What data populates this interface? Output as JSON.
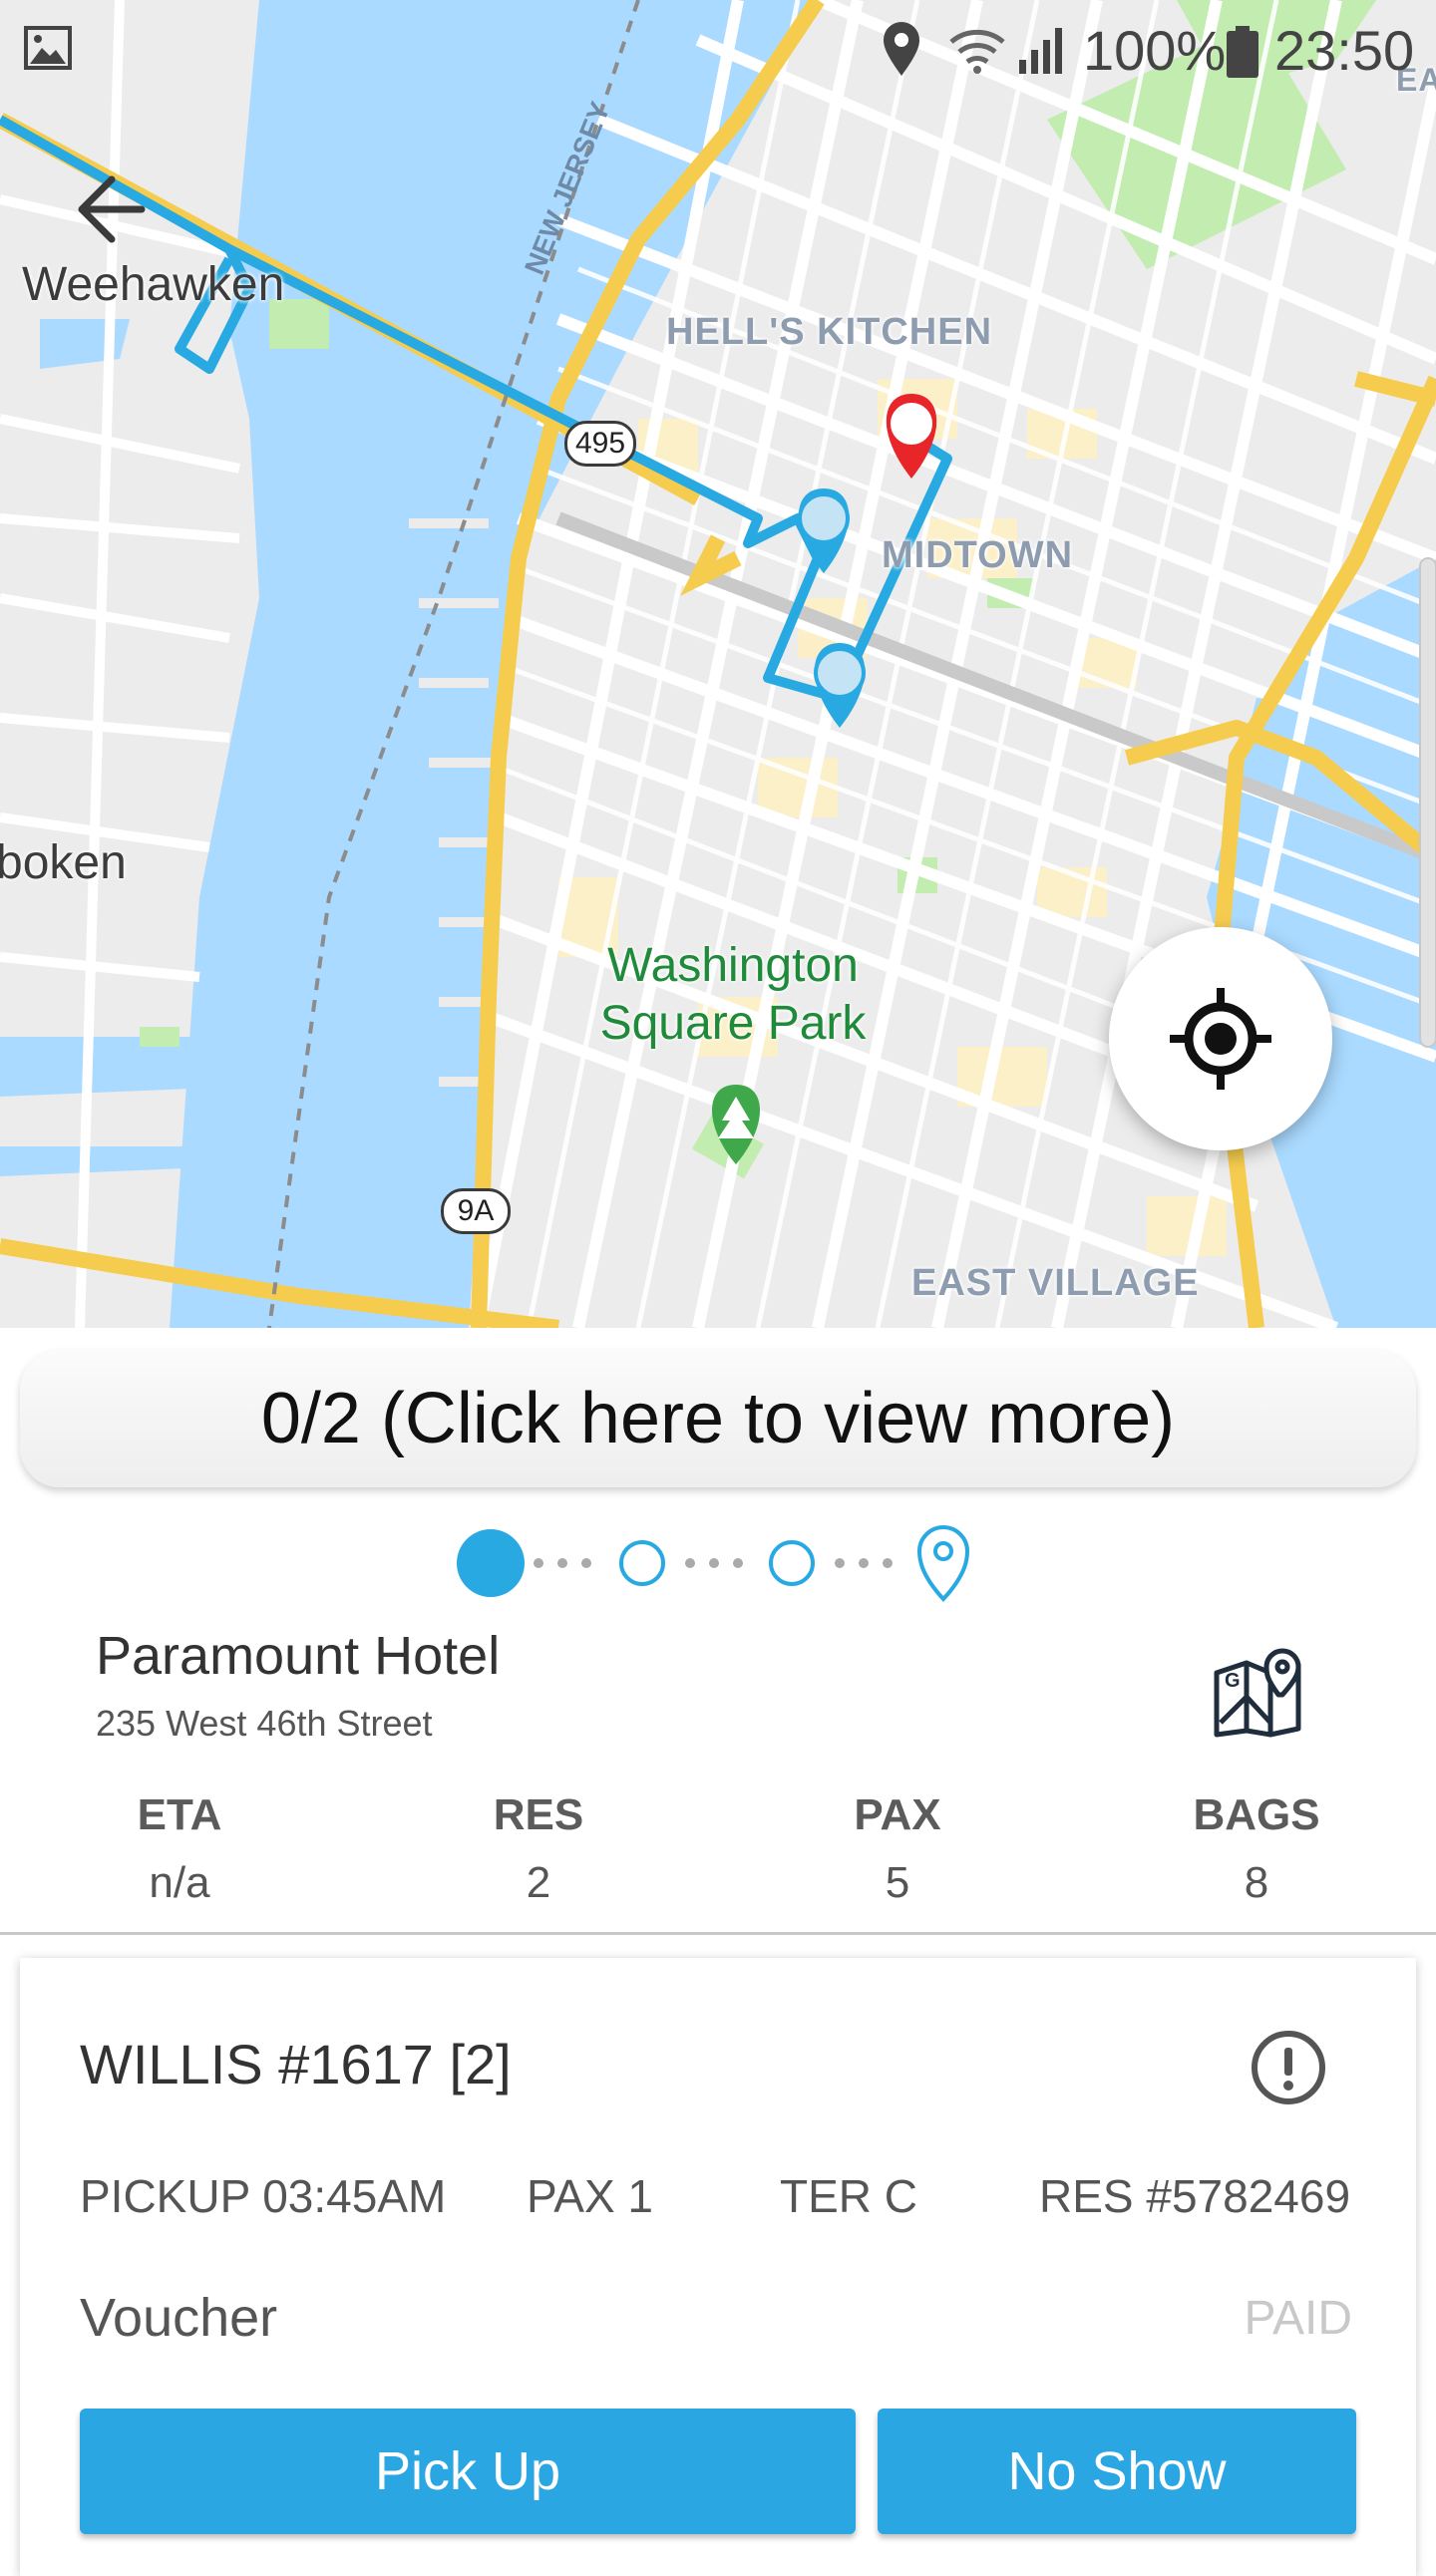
{
  "status_bar": {
    "battery_text": "100%",
    "time": "23:50",
    "icons": [
      "gallery-icon",
      "location-pin-icon",
      "wifi-icon",
      "signal-icon",
      "battery-icon"
    ]
  },
  "map": {
    "labels": {
      "weehawken": "Weehawken",
      "hoboken": "boken",
      "hells_kitchen": "HELL'S KITCHEN",
      "midtown": "MIDTOWN",
      "east_village": "EAST VILLAGE",
      "park_line1": "Washington",
      "park_line2": "Square Park",
      "new_jersey": "NEW JERSEY",
      "corner_east": "EA"
    },
    "shields": {
      "i495": "495",
      "r9a": "9A"
    },
    "colors": {
      "route": "#29a9e1",
      "road_major": "#f6cc4f",
      "water": "#aadaff",
      "park": "#c2ecb0",
      "destination_pin": "#e8262a"
    }
  },
  "panel": {
    "view_more_label": "0/2 (Click here to view more)",
    "stepper": {
      "total_stops": 4,
      "current_index": 0
    },
    "stop": {
      "name": "Paramount Hotel",
      "address": "235 West 46th Street"
    },
    "stats": [
      {
        "label": "ETA",
        "value": "n/a"
      },
      {
        "label": "RES",
        "value": "2"
      },
      {
        "label": "PAX",
        "value": "5"
      },
      {
        "label": "BAGS",
        "value": "8"
      }
    ]
  },
  "passenger": {
    "name": "WILLIS #1617 [2]",
    "pickup": "PICKUP 03:45AM",
    "pax": "PAX 1",
    "terminal": "TER C",
    "reservation": "RES #5782469",
    "payment_type": "Voucher",
    "payment_status": "PAID",
    "pickup_button": "Pick Up",
    "noshow_button": "No Show"
  },
  "accent_color": "#29a9e1"
}
